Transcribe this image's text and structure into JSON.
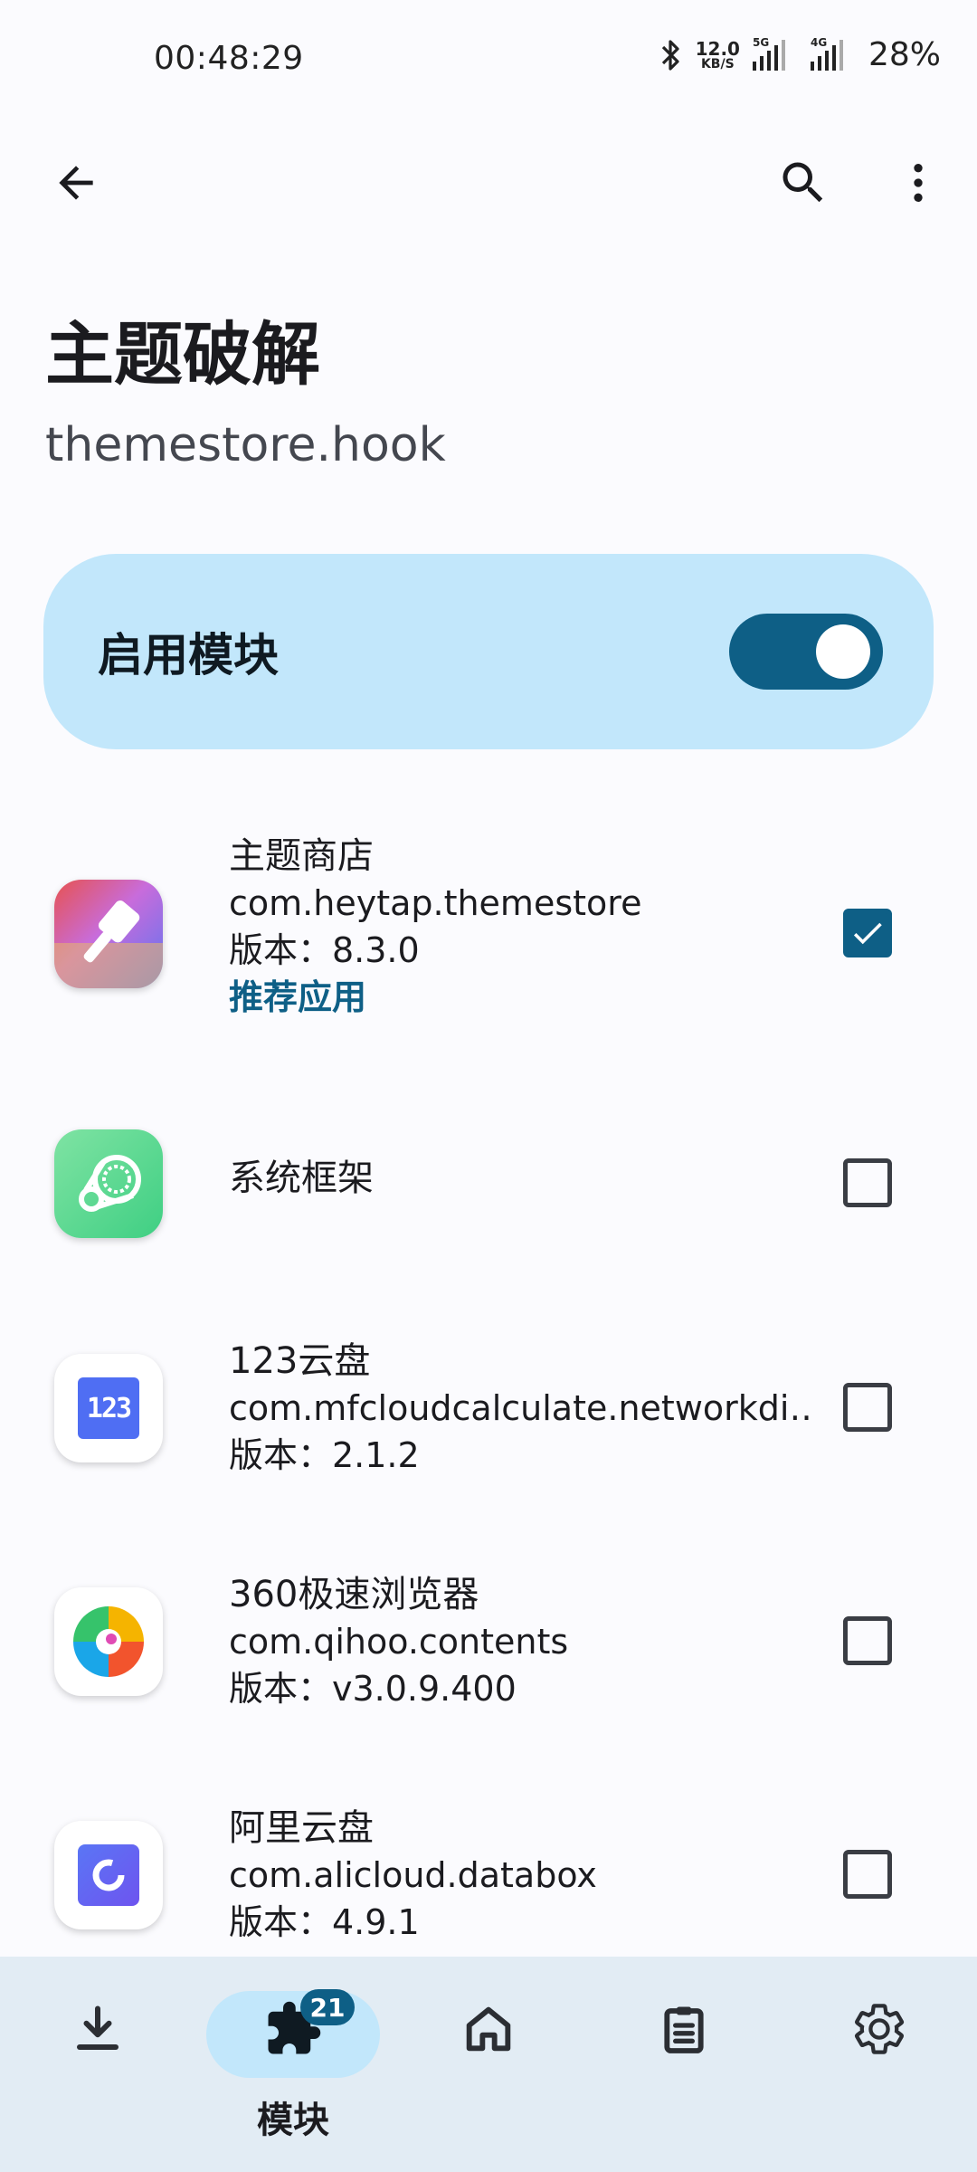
{
  "status_bar": {
    "time": "00:48:29",
    "netspeed_value": "12.0",
    "netspeed_unit": "KB/S",
    "signal1_label": "5G",
    "signal2_label": "4G",
    "battery": "28%"
  },
  "header": {
    "title": "主题破解",
    "subtitle": "themestore.hook"
  },
  "enable_card": {
    "label": "启用模块",
    "enabled": true
  },
  "apps": [
    {
      "name": "主题商店",
      "package": "com.heytap.themestore",
      "version": "版本：8.3.0",
      "recommended": "推荐应用",
      "checked": true
    },
    {
      "name": "系统框架",
      "checked": false
    },
    {
      "name": "123云盘",
      "package": "com.mfcloudcalculate.networkdi‥",
      "version": "版本：2.1.2",
      "checked": false
    },
    {
      "name": "360极速浏览器",
      "package": "com.qihoo.contents",
      "version": "版本：v3.0.9.400",
      "checked": false
    },
    {
      "name": "阿里云盘",
      "package": "com.alicloud.databox",
      "version": "版本：4.9.1",
      "checked": false
    }
  ],
  "bottom_nav": {
    "active_label": "模块",
    "modules_badge": "21",
    "items": [
      "download-icon",
      "puzzle-icon",
      "home-icon",
      "clipboard-icon",
      "gear-icon"
    ]
  },
  "colors": {
    "accent": "#0e5f86",
    "card_bg": "#c2e7fb",
    "nav_bg": "#e2ecf4"
  }
}
